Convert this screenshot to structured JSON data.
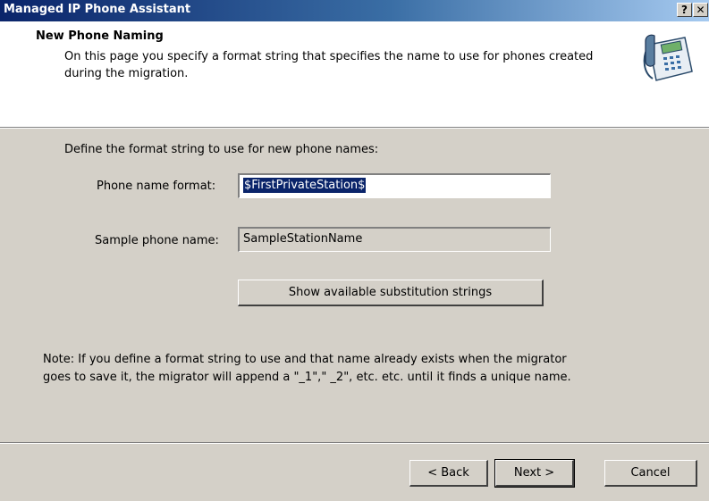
{
  "window": {
    "title": "Managed IP Phone Assistant",
    "help_glyph": "?",
    "close_glyph": "✕"
  },
  "header": {
    "title": "New Phone Naming",
    "description": "On this page you specify a format string that specifies the name to use for phones created during the migration.",
    "icon": "desk-phone-icon"
  },
  "body": {
    "intro": "Define the format string to use for new phone names:",
    "phone_name_format_label": "Phone name format:",
    "phone_name_format_value": "$FirstPrivateStation$",
    "sample_phone_name_label": "Sample phone name:",
    "sample_phone_name_value": "SampleStationName",
    "show_substitution_button": "Show available substitution strings",
    "note_line1": "Note:  If you define a format string to use and that name already exists when the migrator",
    "note_line2": "goes to save it, the migrator will append a \"_1\",\" _2\", etc. etc. until it finds a unique name."
  },
  "footer": {
    "back_label": "< Back",
    "next_label": "Next >",
    "cancel_label": "Cancel"
  },
  "colors": {
    "titlebar_start": "#0a246a",
    "titlebar_end": "#a6caf0",
    "dialog_face": "#d4d0c8",
    "selection": "#0a246a"
  }
}
